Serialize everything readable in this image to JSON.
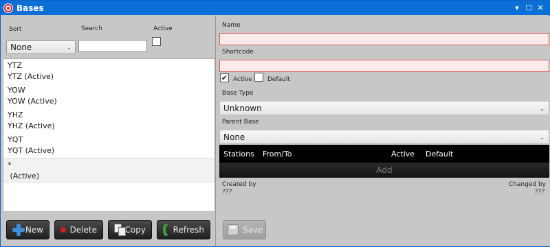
{
  "window": {
    "title": "Bases",
    "controls": [
      "▾",
      "☐",
      "✕"
    ]
  },
  "left": {
    "sort_label": "Sort",
    "search_label": "Search",
    "active_label": "Active",
    "sort_value": "None",
    "search_value": "",
    "items": [
      {
        "code": "YTZ",
        "sub": "YTZ (Active)"
      },
      {
        "code": "YOW",
        "sub": "YOW (Active)"
      },
      {
        "code": "YHZ",
        "sub": "YHZ (Active)"
      },
      {
        "code": "YQT",
        "sub": "YQT (Active)"
      },
      {
        "code": "*",
        "sub": " (Active)"
      }
    ],
    "buttons": {
      "new": "New",
      "delete": "Delete",
      "copy": "Copy",
      "refresh": "Refresh"
    }
  },
  "right": {
    "name_label": "Name",
    "name_value": "",
    "shortcode_label": "Shortcode",
    "shortcode_value": "",
    "active_label": "Active",
    "active_checked": true,
    "default_label": "Default",
    "default_checked": false,
    "base_type_label": "Base Type",
    "base_type_value": "Unknown",
    "parent_base_label": "Parent Base",
    "parent_base_value": "None",
    "grid_columns": [
      "Stations",
      "From/To",
      "Active",
      "Default"
    ],
    "add_label": "Add",
    "created_by_label": "Created by",
    "created_by_value": "???",
    "changed_by_label": "Changed by",
    "changed_by_value": "???",
    "save_label": "Save"
  }
}
